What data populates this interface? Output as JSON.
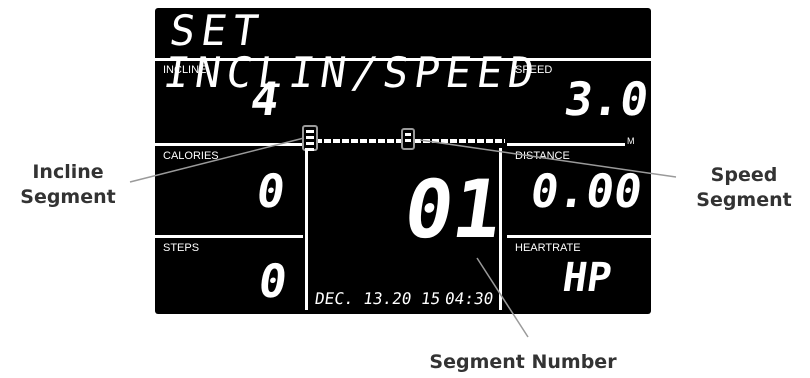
{
  "display": {
    "title": "SET INCLIN/SPEED",
    "incline": {
      "label": "INCLINE",
      "value": "4"
    },
    "speed": {
      "label": "SPEED",
      "value": "3.0",
      "unit": "M"
    },
    "calories": {
      "label": "CALORIES",
      "value": "0"
    },
    "distance": {
      "label": "DISTANCE",
      "value": "0.00"
    },
    "steps": {
      "label": "STEPS",
      "value": "0"
    },
    "heartrate": {
      "label": "HEARTRATE",
      "value": "HP"
    },
    "segment_number": "01",
    "date": "DEC. 13.20 15",
    "time": "04:30"
  },
  "annotations": {
    "incline_segment": [
      "Incline",
      "Segment"
    ],
    "speed_segment": [
      "Speed",
      "Segment"
    ],
    "segment_number": "Segment Number"
  },
  "colors": {
    "lcd_background": "#000000",
    "lcd_text": "#ffffff",
    "annotation_text": "#333333",
    "pointer_line": "#9a9a9a"
  }
}
